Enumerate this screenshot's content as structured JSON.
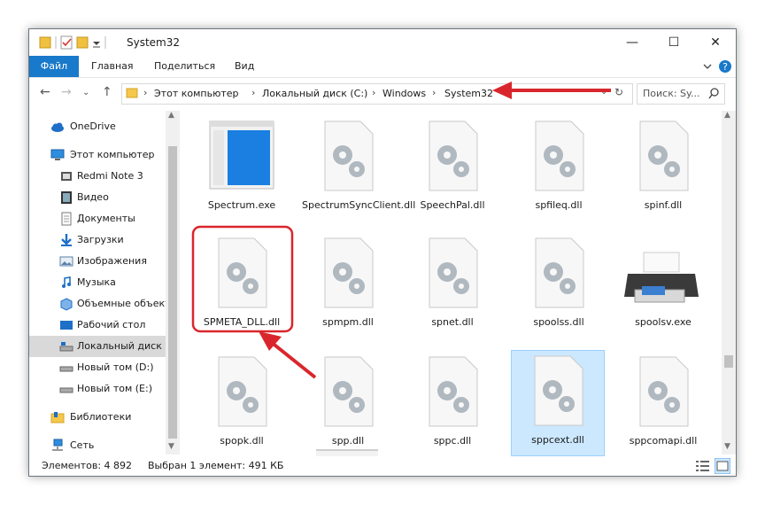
{
  "window": {
    "title": "System32"
  },
  "ribbon": {
    "tabs": [
      "Файл",
      "Главная",
      "Поделиться",
      "Вид"
    ]
  },
  "address": {
    "crumbs": [
      "Этот компьютер",
      "Локальный диск (C:)",
      "Windows",
      "System32"
    ],
    "search_placeholder": "Поиск: Sy..."
  },
  "nav": {
    "items": [
      {
        "label": "OneDrive",
        "icon": "cloud-icon"
      },
      {
        "label": "Этот компьютер",
        "icon": "computer-icon"
      },
      {
        "label": "Redmi Note 3",
        "icon": "phone-icon"
      },
      {
        "label": "Видео",
        "icon": "video-folder-icon"
      },
      {
        "label": "Документы",
        "icon": "documents-folder-icon"
      },
      {
        "label": "Загрузки",
        "icon": "downloads-folder-icon"
      },
      {
        "label": "Изображения",
        "icon": "pictures-folder-icon"
      },
      {
        "label": "Музыка",
        "icon": "music-folder-icon"
      },
      {
        "label": "Объемные объект",
        "icon": "3d-objects-folder-icon"
      },
      {
        "label": "Рабочий стол",
        "icon": "desktop-folder-icon"
      },
      {
        "label": "Локальный диск (",
        "icon": "system-drive-icon"
      },
      {
        "label": "Новый том (D:)",
        "icon": "drive-icon"
      },
      {
        "label": "Новый том (E:)",
        "icon": "drive-icon"
      },
      {
        "label": "Библиотеки",
        "icon": "libraries-icon"
      },
      {
        "label": "Сеть",
        "icon": "network-icon"
      }
    ]
  },
  "files": [
    {
      "name": "Spectrum.exe",
      "icon": "app-window-icon"
    },
    {
      "name": "SpectrumSyncClient.dll",
      "icon": "dll-gear-icon"
    },
    {
      "name": "SpeechPal.dll",
      "icon": "dll-gear-icon"
    },
    {
      "name": "spfileq.dll",
      "icon": "dll-gear-icon"
    },
    {
      "name": "spinf.dll",
      "icon": "dll-gear-icon"
    },
    {
      "name": "SPMETA_DLL.dll",
      "icon": "dll-gear-icon"
    },
    {
      "name": "spmpm.dll",
      "icon": "dll-gear-icon"
    },
    {
      "name": "spnet.dll",
      "icon": "dll-gear-icon"
    },
    {
      "name": "spoolss.dll",
      "icon": "dll-gear-icon"
    },
    {
      "name": "spoolsv.exe",
      "icon": "printer-icon"
    },
    {
      "name": "spopk.dll",
      "icon": "dll-gear-icon"
    },
    {
      "name": "spp.dll",
      "icon": "dll-gear-icon"
    },
    {
      "name": "sppc.dll",
      "icon": "dll-gear-icon"
    },
    {
      "name": "sppcext.dll",
      "icon": "dll-gear-icon"
    },
    {
      "name": "sppcomapi.dll",
      "icon": "dll-gear-icon"
    }
  ],
  "status": {
    "items_count": "Элементов: 4 892",
    "selection": "Выбран 1 элемент: 491 КБ"
  },
  "colors": {
    "accent": "#1979ca",
    "selection": "#cce8ff",
    "annotation": "#d9262c"
  }
}
